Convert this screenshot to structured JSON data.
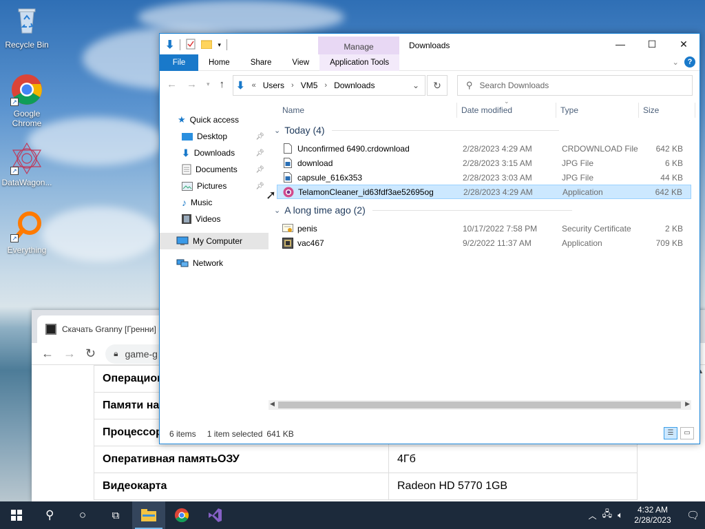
{
  "desktop": {
    "icons": [
      {
        "label": "Recycle Bin",
        "icon": "recycle-bin-icon"
      },
      {
        "label": "Google Chrome",
        "icon": "chrome-icon"
      },
      {
        "label": "DataWagon...",
        "icon": "datawagon-icon"
      },
      {
        "label": "Everything",
        "icon": "everything-icon"
      }
    ]
  },
  "browser": {
    "tab_title": "Скачать Granny [Гренни] н",
    "url_fragment": "game-g",
    "specs": [
      {
        "label": "Операцион",
        "value": ""
      },
      {
        "label": "Памяти на",
        "value": ""
      },
      {
        "label": "Процессор",
        "value": ""
      },
      {
        "label": "Оперативная памятьОЗУ",
        "value": "4Гб"
      },
      {
        "label": "Видеокарта",
        "value": "Radeon HD 5770 1GB"
      }
    ]
  },
  "explorer": {
    "window_title": "Downloads",
    "context_tab": "Manage",
    "ribbon_tabs": [
      "File",
      "Home",
      "Share",
      "View",
      "Application Tools"
    ],
    "breadcrumb": [
      "Users",
      "VM5",
      "Downloads"
    ],
    "breadcrumb_prefix": "«",
    "search_placeholder": "Search Downloads",
    "nav": {
      "quick_access": "Quick access",
      "desktop": "Desktop",
      "downloads": "Downloads",
      "documents": "Documents",
      "pictures": "Pictures",
      "music": "Music",
      "videos": "Videos",
      "my_computer": "My Computer",
      "network": "Network"
    },
    "columns": {
      "name": "Name",
      "date": "Date modified",
      "type": "Type",
      "size": "Size"
    },
    "groups": [
      {
        "title": "Today (4)",
        "files": [
          {
            "name": "Unconfirmed 6490.crdownload",
            "date": "2/28/2023 4:29 AM",
            "type": "CRDOWNLOAD File",
            "size": "642 KB",
            "icon": "blank-file-icon"
          },
          {
            "name": "download",
            "date": "2/28/2023 3:15 AM",
            "type": "JPG File",
            "size": "6 KB",
            "icon": "image-file-icon"
          },
          {
            "name": "capsule_616x353",
            "date": "2/28/2023 3:03 AM",
            "type": "JPG File",
            "size": "44 KB",
            "icon": "image-file-icon"
          },
          {
            "name": "TelamonCleaner_id63fdf3ae52695og",
            "date": "2/28/2023 4:29 AM",
            "type": "Application",
            "size": "642 KB",
            "icon": "telamon-app-icon",
            "selected": true
          }
        ]
      },
      {
        "title": "A long time ago (2)",
        "files": [
          {
            "name": "penis",
            "date": "10/17/2022 7:58 PM",
            "type": "Security Certificate",
            "size": "2 KB",
            "icon": "certificate-icon"
          },
          {
            "name": "vac467",
            "date": "9/2/2022 11:37 AM",
            "type": "Application",
            "size": "709 KB",
            "icon": "app-icon"
          }
        ]
      }
    ],
    "status": {
      "items": "6 items",
      "selected": "1 item selected",
      "size": "641 KB"
    }
  },
  "taskbar": {
    "time": "4:32 AM",
    "date": "2/28/2023"
  }
}
